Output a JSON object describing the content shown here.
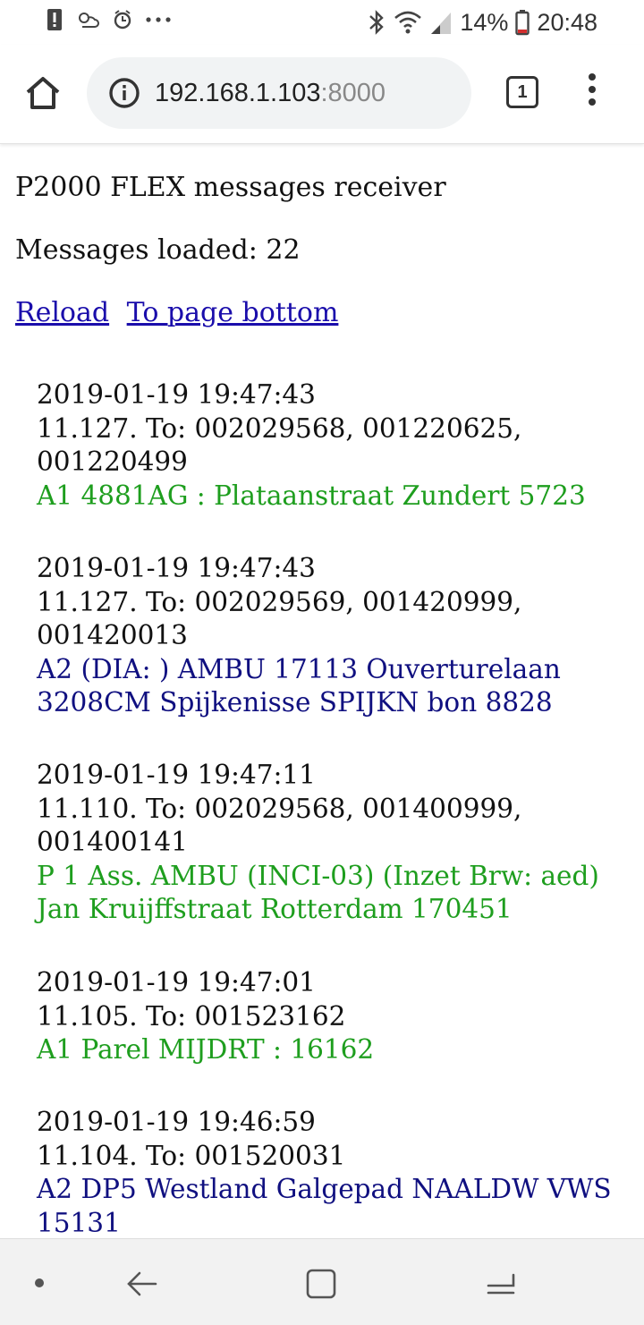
{
  "status_bar": {
    "battery_percent": "14%",
    "time": "20:48",
    "left_icons": [
      "alert-icon",
      "weather-icon",
      "alarm-icon",
      "more-dots-icon"
    ],
    "right_icons": [
      "bluetooth-icon",
      "wifi-icon",
      "signal-icon",
      "battery-icon"
    ]
  },
  "browser": {
    "url_host": "192.168.1.103",
    "url_port": ":8000",
    "tab_count": "1"
  },
  "page": {
    "title": "P2000 FLEX messages receiver",
    "messages_loaded": "Messages loaded: 22",
    "links": {
      "reload": "Reload",
      "to_bottom": "To page bottom"
    }
  },
  "messages": [
    {
      "timestamp": "2019-01-19 19:47:43",
      "header": "11.127. To: 002029568, 001220625, 001220499",
      "body": "A1 4881AG : Plataanstraat Zundert 5723",
      "color": "#1e9e1e"
    },
    {
      "timestamp": "2019-01-19 19:47:43",
      "header": "11.127. To: 002029569, 001420999, 001420013",
      "body": "A2 (DIA: ) AMBU 17113 Ouverturelaan 3208CM Spijkenisse SPIJKN bon 8828",
      "color": "#101080"
    },
    {
      "timestamp": "2019-01-19 19:47:11",
      "header": "11.110. To: 002029568, 001400999, 001400141",
      "body": "P 1 Ass. AMBU (INCI-03) (Inzet Brw: aed) Jan Kruijffstraat Rotterdam 170451",
      "color": "#1e9e1e"
    },
    {
      "timestamp": "2019-01-19 19:47:01",
      "header": "11.105. To: 001523162",
      "body": "A1 Parel MIJDRT : 16162",
      "color": "#1e9e1e"
    },
    {
      "timestamp": "2019-01-19 19:46:59",
      "header": "11.104. To: 001520031",
      "body": "A2 DP5 Westland Galgepad NAALDW VWS 15131",
      "color": "#101080"
    }
  ],
  "nav_bar": {
    "icons": [
      "nav-dot-icon",
      "back-arrow-icon",
      "home-square-icon",
      "recents-icon"
    ]
  }
}
